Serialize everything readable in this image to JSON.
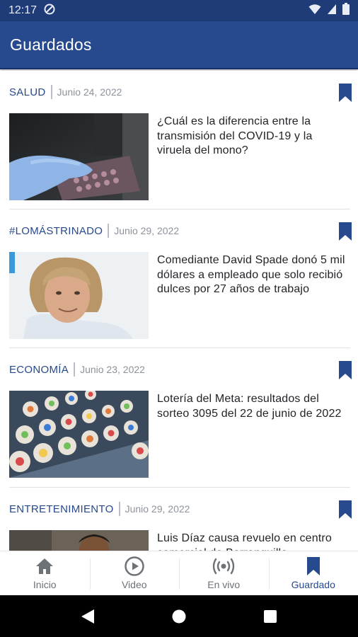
{
  "status_bar": {
    "time": "12:17"
  },
  "app_bar": {
    "title": "Guardados"
  },
  "articles": [
    {
      "section": "SALUD",
      "date": "Junio 24, 2022",
      "headline": "¿Cuál es la diferencia entre la transmisión del COVID-19 y la viruela del mono?",
      "thumbnail": "lab-glove-petri-plate"
    },
    {
      "section": "#LOMÁSTRINADO",
      "date": "Junio 29, 2022",
      "headline": "Comediante David Spade donó 5 mil dólares a empleado que solo recibió dulces por 27 años de trabajo",
      "thumbnail": "man-portrait"
    },
    {
      "section": "ECONOMÍA",
      "date": "Junio 23, 2022",
      "headline": "Lotería del Meta: resultados del sorteo 3095 del 22 de junio de 2022",
      "thumbnail": "lottery-balls"
    },
    {
      "section": "ENTRETENIMIENTO",
      "date": "Junio 29, 2022",
      "headline": "Luis Díaz causa revuelo en centro comercial de Barranquilla",
      "thumbnail": "man-in-mall"
    }
  ],
  "bottom_nav": {
    "items": [
      {
        "label": "Inicio",
        "icon": "home-icon"
      },
      {
        "label": "Video",
        "icon": "play-circle-icon"
      },
      {
        "label": "En vivo",
        "icon": "broadcast-icon"
      },
      {
        "label": "Guardado",
        "icon": "bookmark-icon",
        "active": true
      }
    ]
  },
  "colors": {
    "primary": "#27498d",
    "status_bar": "#1f3b78",
    "date_grey": "#8d939c",
    "divider": "#dfe1e5"
  }
}
